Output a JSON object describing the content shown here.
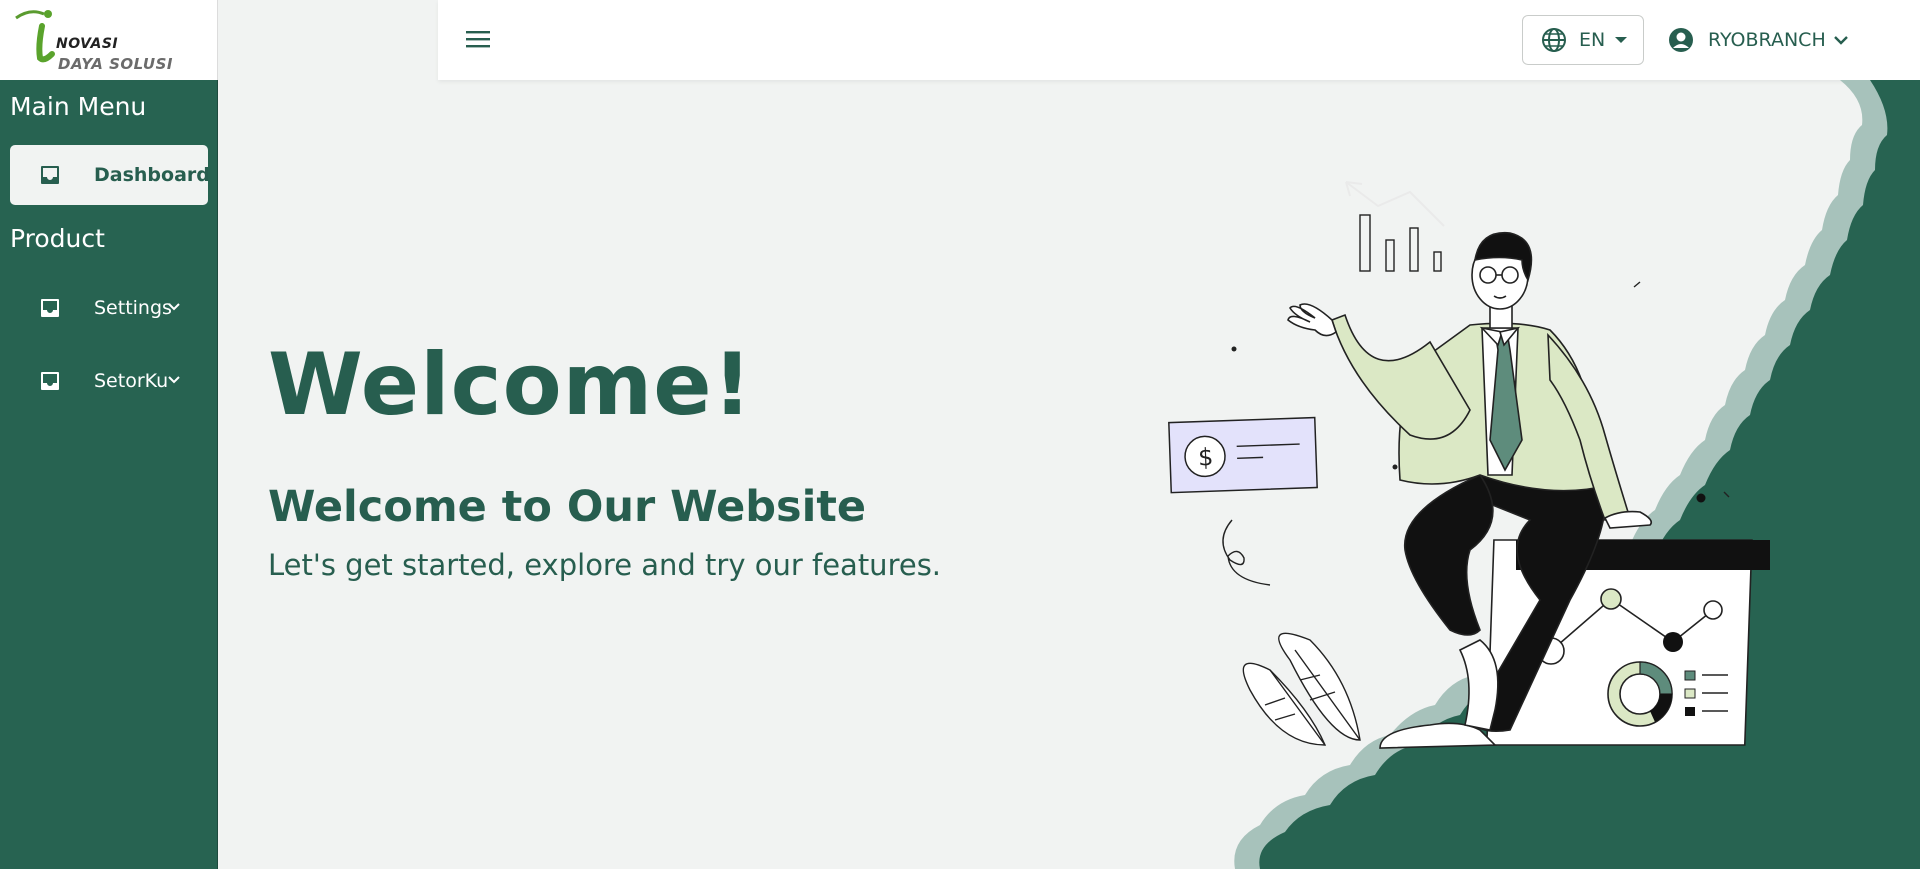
{
  "logo": {
    "line1": "NOVASI",
    "line2": "DAYA SOLUSI",
    "letter": "i"
  },
  "sidebar": {
    "main_menu_title": "Main Menu",
    "product_title": "Product",
    "items": [
      {
        "label": "Dashboard",
        "icon": "inbox-icon",
        "active": true
      },
      {
        "label": "Settings",
        "icon": "inbox-icon",
        "has_submenu": true
      },
      {
        "label": "SetorKu",
        "icon": "inbox-icon",
        "has_submenu": true
      }
    ]
  },
  "header": {
    "menu_icon": "hamburger-icon",
    "language": {
      "label": "EN",
      "icon": "globe-icon"
    },
    "user": {
      "name": "RYOBRANCH",
      "icon": "user-circle-icon"
    }
  },
  "main": {
    "heading": "Welcome!",
    "subheading": "Welcome to Our Website",
    "tagline": "Let's get started, explore and try our features."
  },
  "colors": {
    "primary": "#276351",
    "background": "#f1f3f2",
    "accent_light": "#dbe8c5",
    "card_blue": "#e3e2fb"
  }
}
